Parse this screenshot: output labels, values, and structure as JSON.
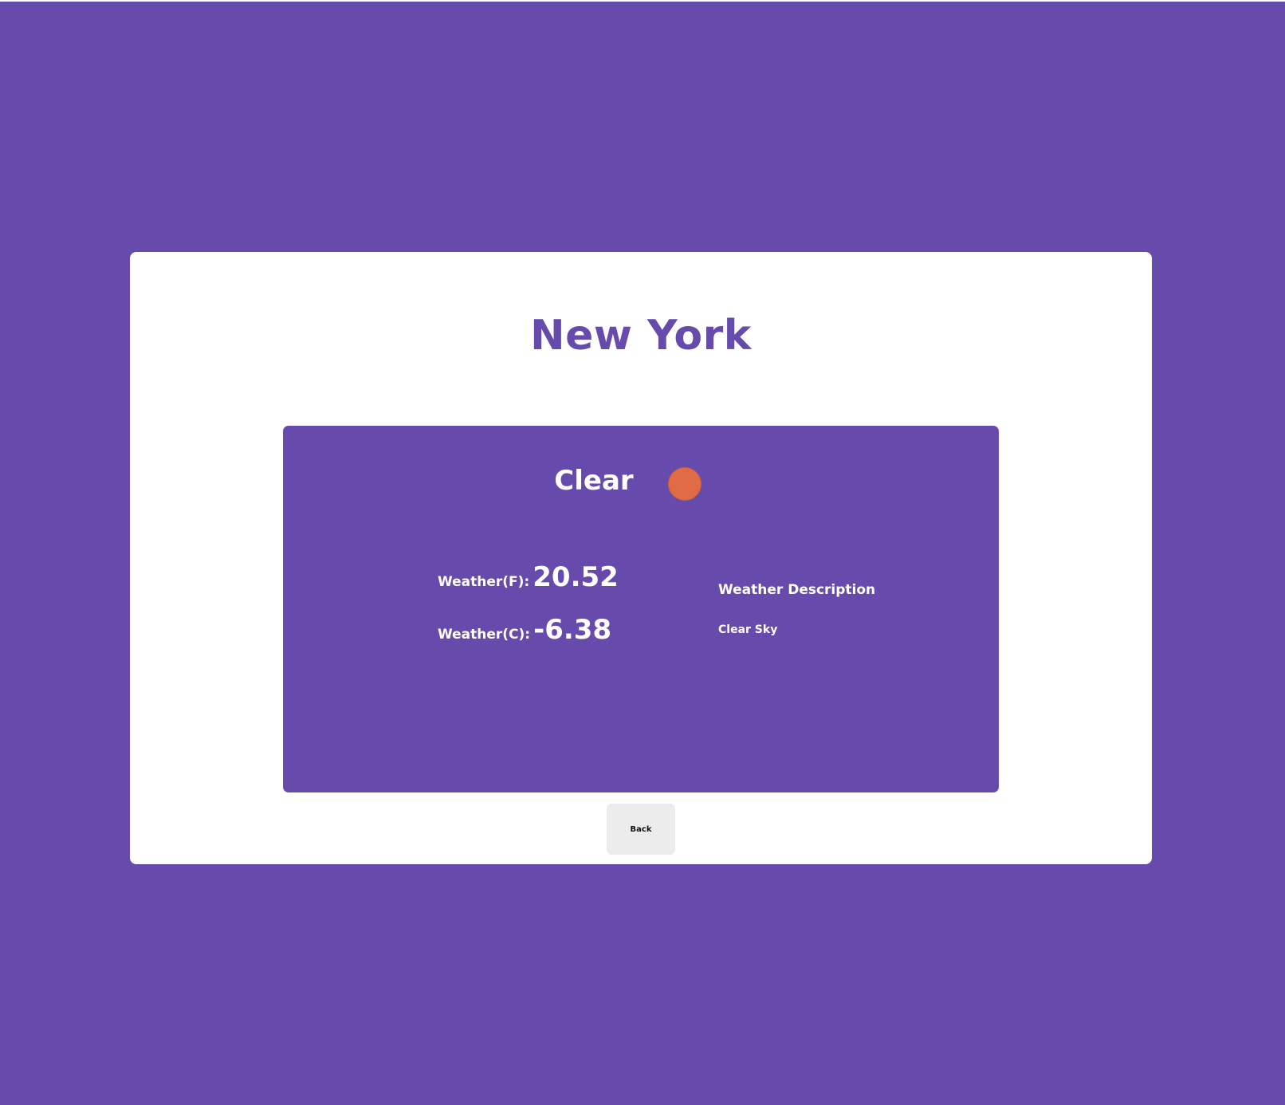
{
  "city": {
    "name": "New York"
  },
  "weather": {
    "condition": "Clear",
    "condition_icon": "sun-icon",
    "fahrenheit_label": "Weather(F):",
    "fahrenheit_value": "20.52",
    "celsius_label": "Weather(C):",
    "celsius_value": "-6.38",
    "description_heading": "Weather Description",
    "description_text": "Clear Sky"
  },
  "actions": {
    "back_label": "Back"
  },
  "colors": {
    "brand_purple": "#664aac",
    "card_background": "#ffffff",
    "sun_orange": "#e06b44",
    "button_background": "#ececec"
  }
}
